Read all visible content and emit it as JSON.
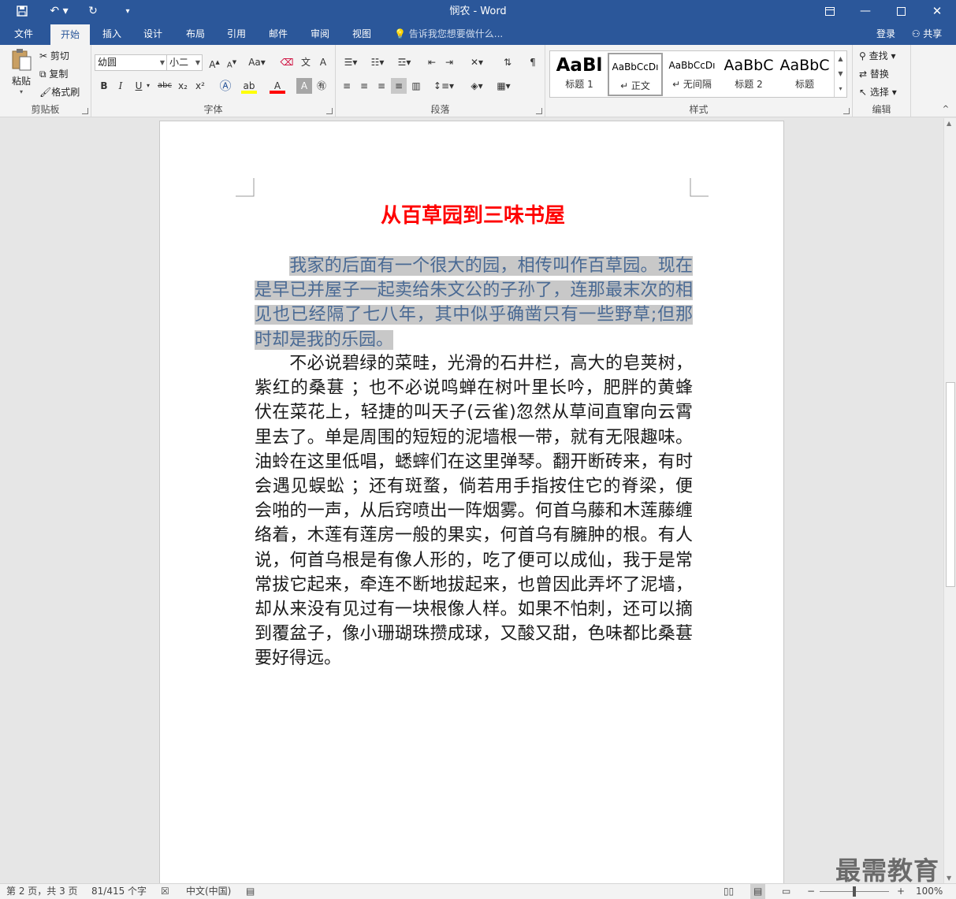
{
  "titlebar": {
    "title": "悯农 - Word",
    "save_icon": "save-icon",
    "undo_icon": "undo-icon",
    "redo_icon": "redo-icon",
    "customize_icon": "customize-quick-access-icon",
    "ribbon_display_icon": "ribbon-display-options-icon",
    "minimize_icon": "minimize-icon",
    "maximize_icon": "maximize-icon",
    "close_icon": "close-icon"
  },
  "tabs": [
    "文件",
    "开始",
    "插入",
    "设计",
    "布局",
    "引用",
    "邮件",
    "审阅",
    "视图"
  ],
  "active_tab": "开始",
  "tellme": "告诉我您想要做什么...",
  "login": "登录",
  "share": "共享",
  "ribbon": {
    "clipboard": {
      "label": "剪贴板",
      "paste": "粘贴",
      "cut": "剪切",
      "copy": "复制",
      "format_painter": "格式刷"
    },
    "font": {
      "label": "字体",
      "font_name": "幼圆",
      "font_size": "小二",
      "bold": "B",
      "italic": "I",
      "underline": "U",
      "strike": "abc",
      "sub": "x₂",
      "sup": "x²",
      "aa": "Aa"
    },
    "paragraph": {
      "label": "段落"
    },
    "styles": {
      "label": "样式",
      "items": [
        {
          "preview": "AaBl",
          "name": "标题 1"
        },
        {
          "preview": "AaBbCcDı",
          "name": "↵ 正文"
        },
        {
          "preview": "AaBbCcDı",
          "name": "↵ 无间隔"
        },
        {
          "preview": "AaBbC",
          "name": "标题 2"
        },
        {
          "preview": "AaBbC",
          "name": "标题"
        }
      ]
    },
    "editing": {
      "label": "编辑",
      "find": "查找",
      "replace": "替换",
      "select": "选择"
    }
  },
  "document": {
    "title": "从百草园到三味书屋",
    "para1_selected": "我家的后面有一个很大的园，相传叫作百草园。现在是早已并屋子一起卖给朱文公的子孙了，连那最末次的相见也已经隔了七八年，其中似乎确凿只有一些野草;但那时却是我的乐园。",
    "para2": "不必说碧绿的菜畦，光滑的石井栏，高大的皂荚树，紫红的桑葚 ；也不必说鸣蝉在树叶里长吟，肥胖的黄蜂伏在菜花上，轻捷的叫天子(云雀)忽然从草间直窜向云霄里去了。单是周围的短短的泥墙根一带，就有无限趣味。油蛉在这里低唱，蟋蟀们在这里弹琴。翻开断砖来，有时会遇见蜈蚣 ；还有斑蝥，倘若用手指按住它的脊梁，便会啪的一声，从后窍喷出一阵烟雾。何首乌藤和木莲藤缠络着，木莲有莲房一般的果实，何首乌有臃肿的根。有人说，何首乌根是有像人形的，吃了便可以成仙，我于是常常拔它起来，牵连不断地拔起来，也曾因此弄坏了泥墙，却从来没有见过有一块根像人样。如果不怕刺，还可以摘到覆盆子，像小珊瑚珠攒成球，又酸又甜，色味都比桑葚要好得远。"
  },
  "status": {
    "page": "第 2 页，共 3 页",
    "words": "81/415 个字",
    "language": "中文(中国)",
    "zoom": "100%"
  },
  "watermark": "最需教育",
  "colors": {
    "accent": "#2b579a",
    "title_red": "#ff0000",
    "selection": "#c8c8c8"
  }
}
